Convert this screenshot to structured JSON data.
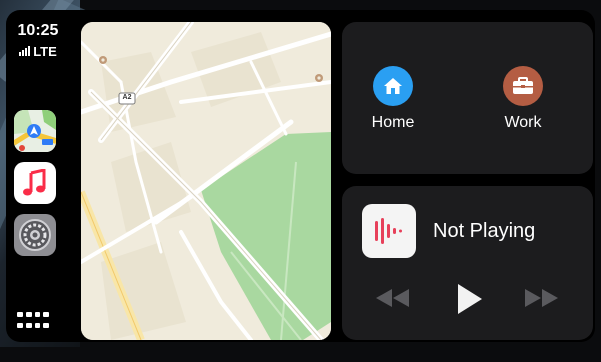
{
  "status": {
    "time": "10:25",
    "network": "LTE"
  },
  "sidebar": {
    "apps": [
      {
        "name": "Maps",
        "icon": "maps-icon"
      },
      {
        "name": "Music",
        "icon": "music-icon"
      },
      {
        "name": "Settings",
        "icon": "settings-icon"
      }
    ],
    "home_button_icon": "app-grid-icon"
  },
  "map": {
    "road_label": "A2"
  },
  "destinations": [
    {
      "label": "Home",
      "icon": "house-icon",
      "color": "#2a9ff2"
    },
    {
      "label": "Work",
      "icon": "briefcase-icon",
      "color": "#b45d43"
    }
  ],
  "now_playing": {
    "title": "Not Playing",
    "controls": [
      "previous-icon",
      "play-icon",
      "next-icon"
    ]
  },
  "colors": {
    "map_land": "#f0ebdc",
    "map_park": "#a9d8a0",
    "panel_bg": "#1c1c1e",
    "music_accent": "#e7405a"
  }
}
